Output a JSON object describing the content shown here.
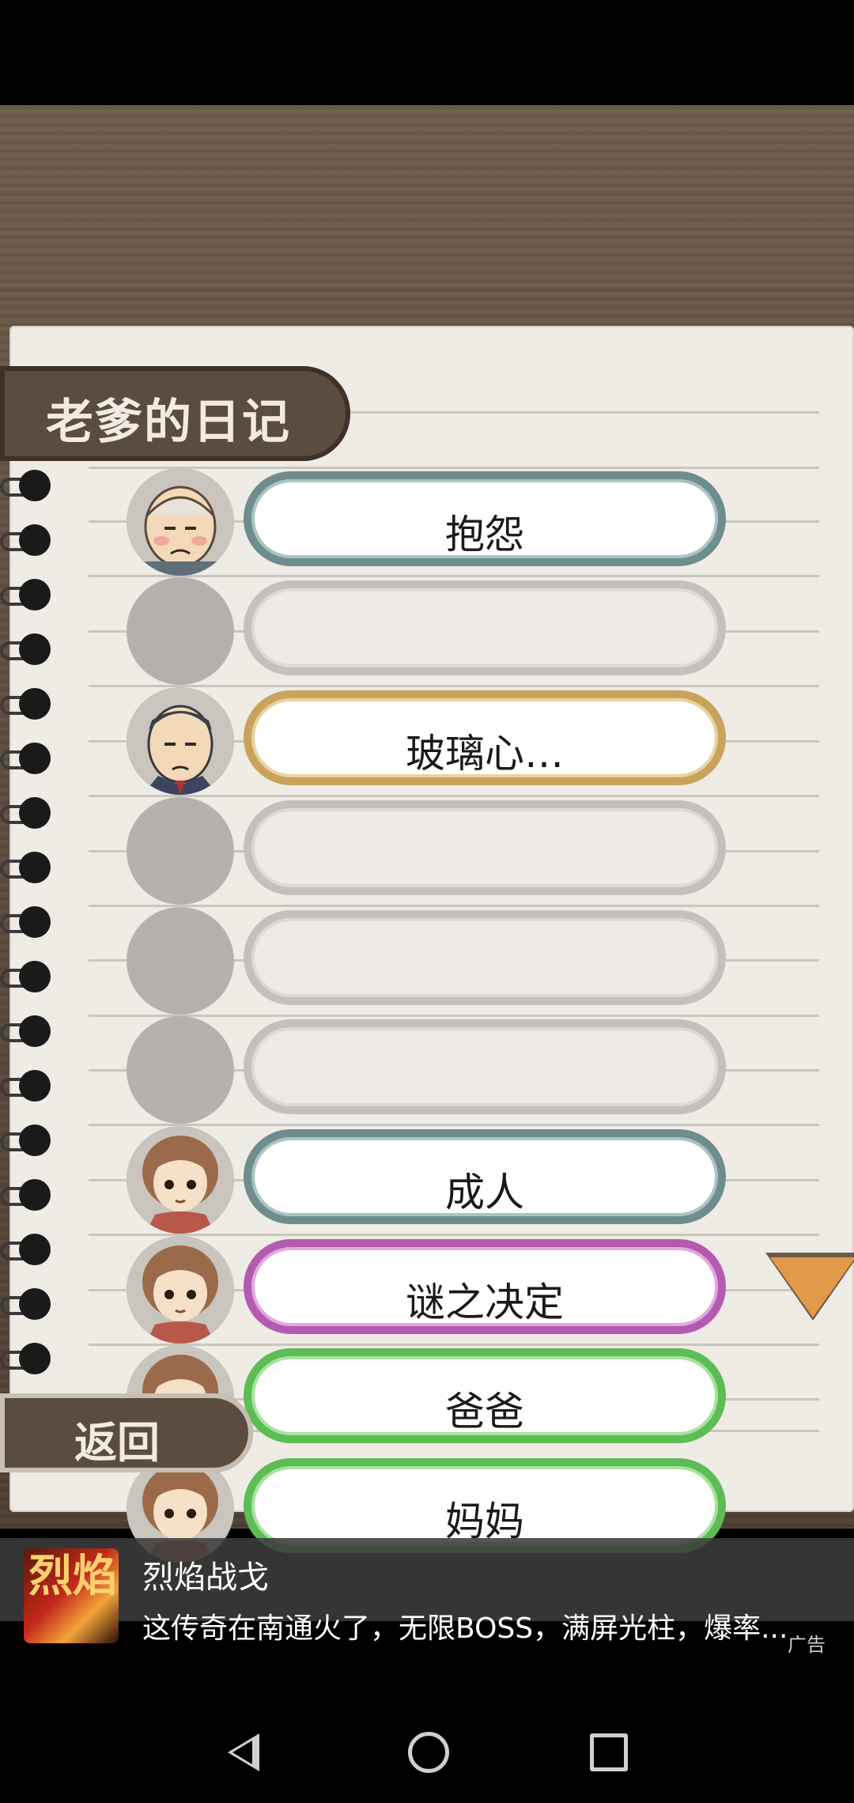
{
  "diary": {
    "title": "老爹的日记",
    "back_label": "返回",
    "entries": [
      {
        "label": "抱怨",
        "style": "teal",
        "avatar": "old-man-face"
      },
      {
        "label": "",
        "style": "empty",
        "avatar": "locked"
      },
      {
        "label": "玻璃心…",
        "style": "gold",
        "avatar": "businessman-face"
      },
      {
        "label": "",
        "style": "empty",
        "avatar": "locked"
      },
      {
        "label": "",
        "style": "empty",
        "avatar": "locked"
      },
      {
        "label": "",
        "style": "empty",
        "avatar": "locked"
      },
      {
        "label": "成人",
        "style": "teal",
        "avatar": "girl-face"
      },
      {
        "label": "谜之决定",
        "style": "pink",
        "avatar": "girl-face"
      },
      {
        "label": "爸爸",
        "style": "green",
        "avatar": "girl-face"
      },
      {
        "label": "妈妈",
        "style": "green",
        "avatar": "girl-face"
      }
    ]
  },
  "ad": {
    "icon_text": "烈焰",
    "title": "烈焰战戈",
    "description": "这传奇在南通火了，无限BOSS，满屏光柱，爆率...",
    "label": "广告"
  },
  "colors": {
    "wood": "#5f4f40",
    "paper": "#efebe5",
    "tab": "#5b4c40",
    "arrow": "#e39a48"
  }
}
